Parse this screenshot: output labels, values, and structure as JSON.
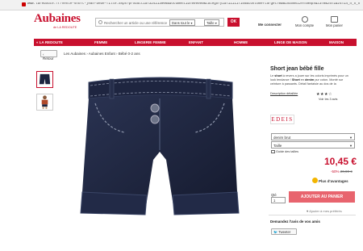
{
  "browser": {
    "url": "www.laredoute.fr/vente-short-jean-bebe-fille.aspx?productid=324213006&documentid=999999&categoryid=111117155&customertarget=0&windowsize=400px&z3=0&z5=1&z4=14_n_n_n_n"
  },
  "header": {
    "logo": "Aubaines",
    "logo_sub": "de LA REDOUTE",
    "search_placeholder": "Rechercher un article ou une référence",
    "select_department": "Dans tout le ▾",
    "select_size": "Taille ▾",
    "ok_label": "OK",
    "login_label": "Me connecter",
    "account_label": "Mon compte",
    "cart_label": "Mon panier"
  },
  "nav": {
    "items": [
      "« LA REDOUTE",
      "FEMME",
      "LINGERIE FEMME",
      "ENFANT",
      "HOMME",
      "LINGE DE MAISON",
      "MAISON"
    ]
  },
  "breadcrumb": {
    "back_label": "‹ Retour",
    "path": "Les Aubaines › Aubaines Enfant › Bébé 0-2 ans"
  },
  "product": {
    "title": "Short jean bébé fille",
    "desc_lead": "Le ",
    "desc_bold1": "short",
    "desc_mid": " à revers a jouer sur les coloris imprimés pour un look tendance ! ",
    "desc_bold2": "Short",
    "desc_mid2": " en ",
    "desc_bold3": "denim",
    "desc_tail": " pur coton. Monté sur ceinture à passants. Détail fantaisie au dos de la",
    "more_label": "Description détaillée",
    "stars": "★★★☆",
    "reviews_label": "Voir les 3 avis",
    "brand": "EDEIS",
    "color_value": "denim brut",
    "size_value": "Taille",
    "size_guide": "Guide des tailles",
    "price": "10,45 €",
    "discount_pct": "-50%",
    "old_price": "20,90 €",
    "plus_label": "Plus d'avantages",
    "qty_label": "Qté",
    "qty_value": "1",
    "add_to_cart": "AJOUTER AU PANIER",
    "add_selection": "♥ Ajouter à mes préférés",
    "demande_label": "Demandez l'avis de vos amis",
    "tweet_label": "🐦 Tweeter"
  },
  "colors": {
    "brand_red": "#c8102e",
    "cart_button": "#e8646e",
    "denim": "#1d2540"
  }
}
